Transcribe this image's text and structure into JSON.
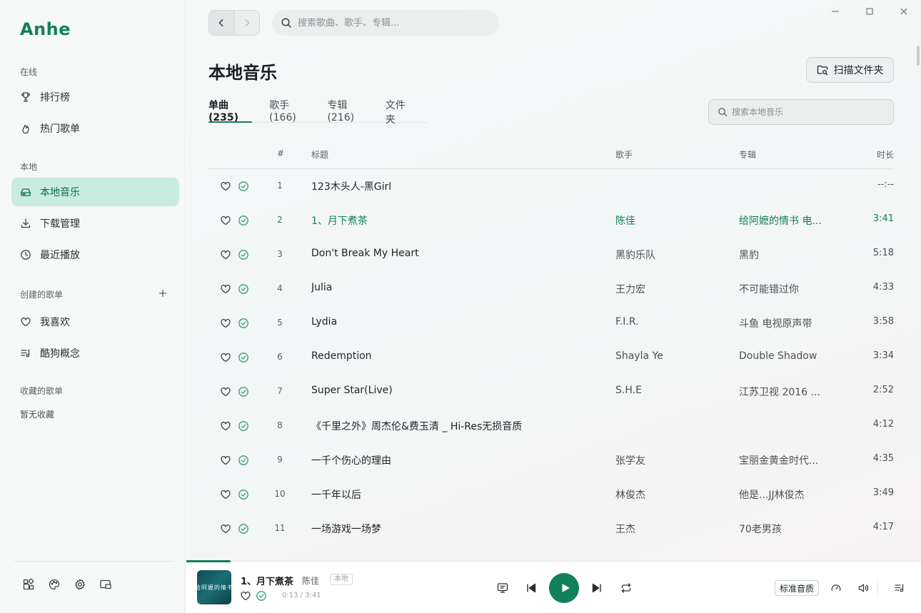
{
  "app": {
    "name": "Anhe"
  },
  "sidebar": {
    "online_label": "在线",
    "online_items": [
      {
        "label": "排行榜",
        "icon": "trophy-icon"
      },
      {
        "label": "热门歌单",
        "icon": "flame-icon"
      }
    ],
    "local_label": "本地",
    "local_items": [
      {
        "label": "本地音乐",
        "icon": "hard-drive-icon",
        "active": true
      },
      {
        "label": "下载管理",
        "icon": "download-icon"
      },
      {
        "label": "最近播放",
        "icon": "clock-icon"
      }
    ],
    "created_label": "创建的歌单",
    "created_items": [
      {
        "label": "我喜欢",
        "icon": "heart-icon"
      },
      {
        "label": "酷狗概念",
        "icon": "playlist-icon"
      }
    ],
    "collected_label": "收藏的歌单",
    "collected_empty": "暂无收藏",
    "bottom_tools": [
      "apps-icon",
      "palette-icon",
      "settings-icon",
      "mini-player-icon"
    ]
  },
  "topbar": {
    "search_placeholder": "搜索歌曲、歌手、专辑..."
  },
  "page": {
    "title": "本地音乐",
    "scan_button": "扫描文件夹",
    "tabs": [
      {
        "label": "单曲 (235)",
        "active": true
      },
      {
        "label": "歌手 (166)"
      },
      {
        "label": "专辑 (216)"
      },
      {
        "label": "文件夹"
      }
    ],
    "local_search_placeholder": "搜索本地音乐"
  },
  "table": {
    "headers": {
      "num": "#",
      "title": "标题",
      "artist": "歌手",
      "album": "专辑",
      "duration": "时长"
    },
    "rows": [
      {
        "num": "1",
        "title": "123木头人-黑Girl",
        "artist": "",
        "album": "",
        "duration": "--:--"
      },
      {
        "num": "2",
        "title": "1、月下煮茶",
        "artist": "陈佳",
        "album": "给阿嬷的情书 电...",
        "duration": "3:41",
        "playing": true
      },
      {
        "num": "3",
        "title": "Don't Break My Heart",
        "artist": "黑豹乐队",
        "album": "黑豹",
        "duration": "5:18"
      },
      {
        "num": "4",
        "title": "Julia",
        "artist": "王力宏",
        "album": "不可能错过你",
        "duration": "4:33"
      },
      {
        "num": "5",
        "title": "Lydia",
        "artist": "F.I.R.",
        "album": "斗鱼 电视原声带",
        "duration": "3:58"
      },
      {
        "num": "6",
        "title": "Redemption",
        "artist": "Shayla Ye",
        "album": "Double Shadow",
        "duration": "3:34"
      },
      {
        "num": "7",
        "title": "Super Star(Live)",
        "artist": "S.H.E",
        "album": "江苏卫视 2016 ...",
        "duration": "2:52"
      },
      {
        "num": "8",
        "title": "《千里之外》周杰伦&费玉清 _ Hi-Res无损音质",
        "artist": "",
        "album": "",
        "duration": "4:12"
      },
      {
        "num": "9",
        "title": "一千个伤心的理由",
        "artist": "张学友",
        "album": "宝丽金黄金时代...",
        "duration": "4:35"
      },
      {
        "num": "10",
        "title": "一千年以后",
        "artist": "林俊杰",
        "album": "他是...JJ林俊杰",
        "duration": "3:49"
      },
      {
        "num": "11",
        "title": "一场游戏一场梦",
        "artist": "王杰",
        "album": "70老男孩",
        "duration": "4:17"
      }
    ]
  },
  "player": {
    "title": "1、月下煮茶",
    "artist": "陈佳",
    "source_badge": "本地",
    "time": "0:13 / 3:41",
    "progress_fraction": 0.06,
    "quality": "标准音质",
    "cover_text": "给阿嬷的情书"
  },
  "colors": {
    "accent": "#11805c",
    "active_nav_bg": "#c9ece0",
    "check": "#2aa07a"
  }
}
